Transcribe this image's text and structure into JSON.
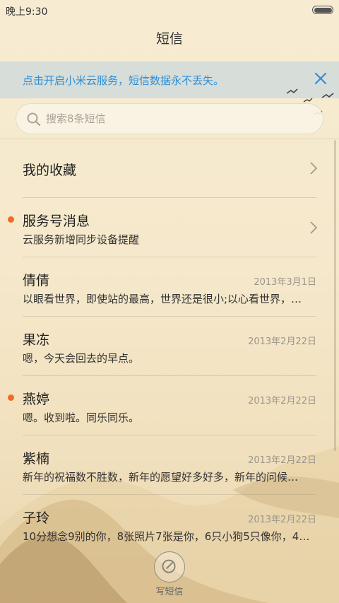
{
  "status_bar": {
    "time": "晚上9:30"
  },
  "header": {
    "title": "短信"
  },
  "banner": {
    "text": "点击开启小米云服务，短信数据永不丢失。"
  },
  "search": {
    "placeholder": "搜索8条短信"
  },
  "favorites": {
    "label": "我的收藏"
  },
  "service": {
    "name": "服务号消息",
    "preview": "云服务新增同步设备提醒",
    "unread": true
  },
  "conversations": [
    {
      "name": "倩倩",
      "date": "2013年3月1日",
      "preview": "以眼看世界，即使站的最高，世界还是很小;以心看世界，…",
      "unread": false
    },
    {
      "name": "果冻",
      "date": "2013年2月22日",
      "preview": "嗯，今天会回去的早点。",
      "unread": false
    },
    {
      "name": "燕婷",
      "date": "2013年2月22日",
      "preview": "嗯。收到啦。同乐同乐。",
      "unread": true
    },
    {
      "name": "紫楠",
      "date": "2013年2月22日",
      "preview": "新年的祝福数不胜数，新年的愿望好多好多，新年的问候…",
      "unread": false
    },
    {
      "name": "子玲",
      "date": "2013年2月22日",
      "preview": "10分想念9别的你，8张照片7张是你，6只小狗5只像你，4…",
      "unread": false
    }
  ],
  "compose": {
    "label": "写短信"
  },
  "colors": {
    "accent_blue": "#2f8fd8",
    "unread_dot": "#f26a25",
    "background": "#f5e8cb"
  }
}
